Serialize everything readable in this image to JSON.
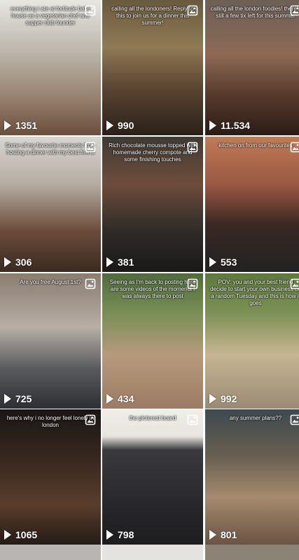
{
  "tiles": [
    {
      "id": "t1",
      "views": "1351",
      "caption": "everything i ate at fortitude bake house as a vegetarian chef and supper club founder",
      "bg": "linear-gradient(180deg,#e8e6e1 0%,#b9b3a8 40%,#9a8573 70%,#6b4e3c 100%)"
    },
    {
      "id": "t2",
      "views": "990",
      "caption": "calling all the londoners! Reply to this to join us for a dinner this summer!",
      "bg": "linear-gradient(180deg,#6a5a3e 0%,#8f7a55 35%,#5a4531 65%,#2b2018 100%)"
    },
    {
      "id": "t3",
      "views": "11.534",
      "caption": "calling all the london foodies! there's still a few tix left for this summer",
      "bg": "linear-gradient(180deg,#6d5f57 0%,#8d6a55 40%,#583a2c 70%,#2a1c16 100%)"
    },
    {
      "id": "t4",
      "views": "306",
      "caption": "Some of my favourite moments from hosting a dinner with my best friend",
      "bg": "linear-gradient(180deg,#d8d5d0 0%,#b5aca2 35%,#6b4c3a 70%,#3a2a20 100%)"
    },
    {
      "id": "t5",
      "views": "381",
      "caption": "Rich chocolate mousse topped with homemade cherry compote and some finishing touches",
      "bg": "linear-gradient(180deg,#3f3b36 0%,#6d4d3a 35%,#2e2b29 70%,#1a1817 100%)"
    },
    {
      "id": "t6",
      "views": "553",
      "caption": "kitchen on from our favourites",
      "bg": "linear-gradient(180deg,#c07b55 0%,#9b5844 35%,#3a2824 65%,#222 100%)"
    },
    {
      "id": "t7",
      "views": "725",
      "caption": "Are you free August 1st?",
      "bg": "linear-gradient(180deg,#8a7c70 0%,#b7aea6 40%,#5b5c60 70%,#2c2f33 100%)"
    },
    {
      "id": "t8",
      "views": "434",
      "caption": "Seeing as I'm back to posting here are some videos of the moments I was always there to post",
      "bg": "linear-gradient(180deg,#4f6b3c 0%,#7a8f57 30%,#b79a7c 60%,#9b7b63 100%)"
    },
    {
      "id": "t9",
      "views": "992",
      "caption": "POV: you and your best friend decide to start your own business on a random Tuesday and this is how it goes",
      "bg": "linear-gradient(180deg,#5d7a3a 0%,#7e9157 30%,#c6b592 60%,#9a8a74 100%)"
    },
    {
      "id": "t10",
      "views": "1065",
      "caption": "here's why i no longer feel lonely in london",
      "bg": "linear-gradient(180deg,#1a1614 0%,#3a2a20 40%,#5a3e2c 70%,#251b16 100%)"
    },
    {
      "id": "t11",
      "views": "798",
      "caption": "the pinterest board",
      "bg": "linear-gradient(180deg,#f0eee9 0%,#e8e4de 20%,#3a3a3e 30%,#26262a 75%,#1d1d20 100%)"
    },
    {
      "id": "t12",
      "views": "801",
      "caption": "any summer plans??",
      "bg": "linear-gradient(180deg,#3d4a4f 0%,#6a5f52 35%,#a58a6e 65%,#6b5444 100%)"
    }
  ],
  "partial_row": [
    {
      "id": "p1",
      "bg": "#b9b6b1"
    },
    {
      "id": "p2",
      "bg": "#e4e3e0"
    },
    {
      "id": "p3",
      "bg": "#8a8376"
    }
  ]
}
